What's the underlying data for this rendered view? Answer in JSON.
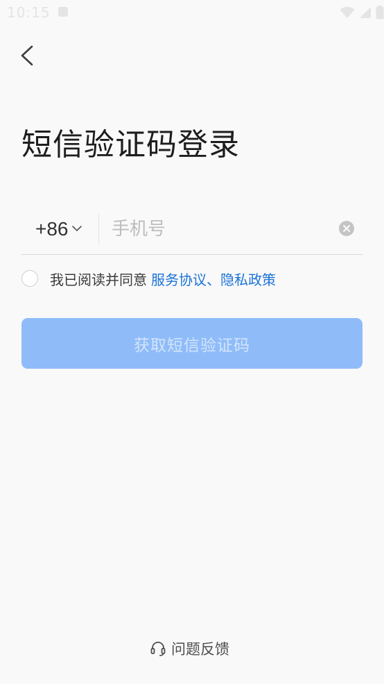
{
  "status_bar": {
    "time": "10:15"
  },
  "page": {
    "title": "短信验证码登录"
  },
  "phone_form": {
    "country_code": "+86",
    "phone_placeholder": "手机号",
    "phone_value": ""
  },
  "agreement": {
    "prefix": "我已阅读并同意",
    "link_text": "服务协议、隐私政策",
    "checked": false
  },
  "primary_button": {
    "label": "获取短信验证码"
  },
  "footer": {
    "feedback_label": "问题反馈"
  },
  "colors": {
    "background": "#f9f9f9",
    "link": "#1a73d9",
    "button_disabled_bg": "#8fbcf9",
    "button_disabled_text": "#d3e4fb"
  },
  "icons": {
    "back": "chevron-left-icon",
    "dropdown": "chevron-down-icon",
    "clear": "clear-circle-icon",
    "feedback": "headset-icon",
    "wifi": "wifi-icon",
    "signal": "signal-icon",
    "battery": "battery-icon",
    "notification": "notification-icon"
  }
}
